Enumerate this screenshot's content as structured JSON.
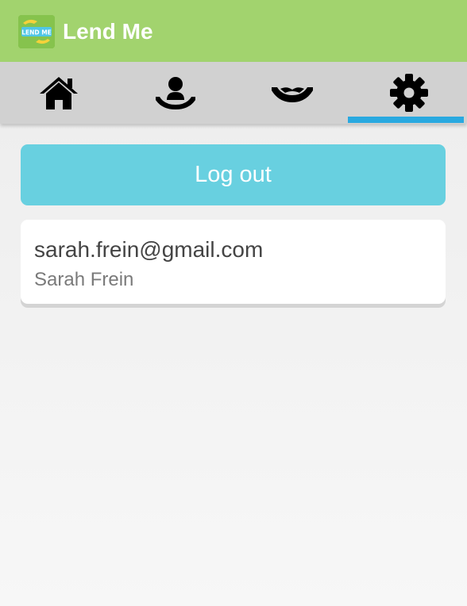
{
  "app": {
    "title": "Lend Me",
    "logo_text": "LEND ME"
  },
  "tabs": [
    {
      "name": "home",
      "icon": "home-icon",
      "active": false
    },
    {
      "name": "receive",
      "icon": "person-in-hand-icon",
      "active": false
    },
    {
      "name": "lend",
      "icon": "handshake-icon",
      "active": false
    },
    {
      "name": "settings",
      "icon": "gear-icon",
      "active": true
    }
  ],
  "settings": {
    "logout_label": "Log out",
    "account": {
      "email": "sarah.frein@gmail.com",
      "name": "Sarah Frein"
    }
  },
  "colors": {
    "app_bar": "#a2d36e",
    "tab_bar": "#d1d1d1",
    "tab_indicator": "#29a9e0",
    "logout_button": "#68d0e0"
  }
}
